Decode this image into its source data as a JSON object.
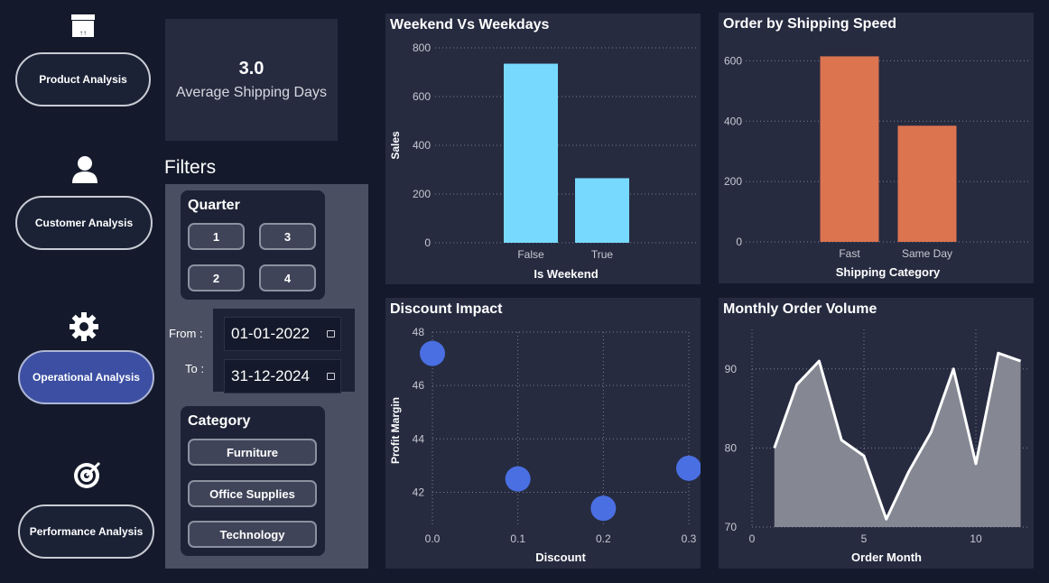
{
  "nav": {
    "items": [
      {
        "label": "Product Analysis",
        "icon": "package-icon",
        "active": false
      },
      {
        "label": "Customer Analysis",
        "icon": "user-icon",
        "active": false
      },
      {
        "label": "Operational Analysis",
        "icon": "gear-icon",
        "active": true
      },
      {
        "label": "Performance Analysis",
        "icon": "target-icon",
        "active": false
      }
    ]
  },
  "kpi": {
    "value": "3.0",
    "label": "Average Shipping Days"
  },
  "filters": {
    "title": "Filters",
    "quarter": {
      "title": "Quarter",
      "options": [
        "1",
        "3",
        "2",
        "4"
      ]
    },
    "date": {
      "from_label": "From :",
      "to_label": "To :",
      "from_value": "01-01-2022",
      "to_value": "31-12-2024"
    },
    "category": {
      "title": "Category",
      "options": [
        "Furniture",
        "Office Supplies",
        "Technology"
      ]
    }
  },
  "colors": {
    "bar_blue": "#78d9ff",
    "bar_orange": "#dd7450",
    "dot_blue": "#4a6fe3",
    "area_grey": "#8a8d98",
    "line_white": "#ffffff"
  },
  "chart_data": [
    {
      "type": "bar",
      "title": "Weekend Vs Weekdays",
      "categories": [
        "False",
        "True"
      ],
      "values": [
        735,
        265
      ],
      "xlabel": "Is Weekend",
      "ylabel": "Sales",
      "ylim": [
        0,
        800
      ],
      "yticks": [
        "0",
        "200",
        "400",
        "600",
        "800"
      ]
    },
    {
      "type": "bar",
      "title": "Order by Shipping Speed",
      "categories": [
        "Fast",
        "Same Day"
      ],
      "values": [
        615,
        385
      ],
      "xlabel": "Shipping Category",
      "ylabel": "",
      "ylim": [
        0,
        700
      ],
      "yticks": [
        "0",
        "200",
        "400",
        "600"
      ]
    },
    {
      "type": "scatter",
      "title": "Discount Impact",
      "x": [
        0.0,
        0.1,
        0.2,
        0.3
      ],
      "y": [
        47.2,
        42.5,
        41.4,
        42.9
      ],
      "xlabel": "Discount",
      "ylabel": "Profit Margin",
      "xlim": [
        0,
        0.3
      ],
      "ylim": [
        40.9,
        48
      ],
      "xticks": [
        "0.0",
        "0.1",
        "0.2",
        "0.3"
      ],
      "yticks": [
        "42",
        "44",
        "46",
        "48"
      ]
    },
    {
      "type": "area",
      "title": "Monthly Order Volume",
      "x": [
        1,
        2,
        3,
        4,
        5,
        6,
        7,
        8,
        9,
        10,
        11,
        12
      ],
      "y": [
        80,
        88,
        91,
        81,
        79,
        71,
        77,
        82,
        90,
        78,
        92,
        91
      ],
      "xlabel": "Order Month",
      "ylabel": "",
      "xlim": [
        0,
        12.5
      ],
      "ylim": [
        70,
        95
      ],
      "xticks": [
        "0",
        "5",
        "10"
      ],
      "yticks": [
        "70",
        "80",
        "90"
      ]
    }
  ]
}
